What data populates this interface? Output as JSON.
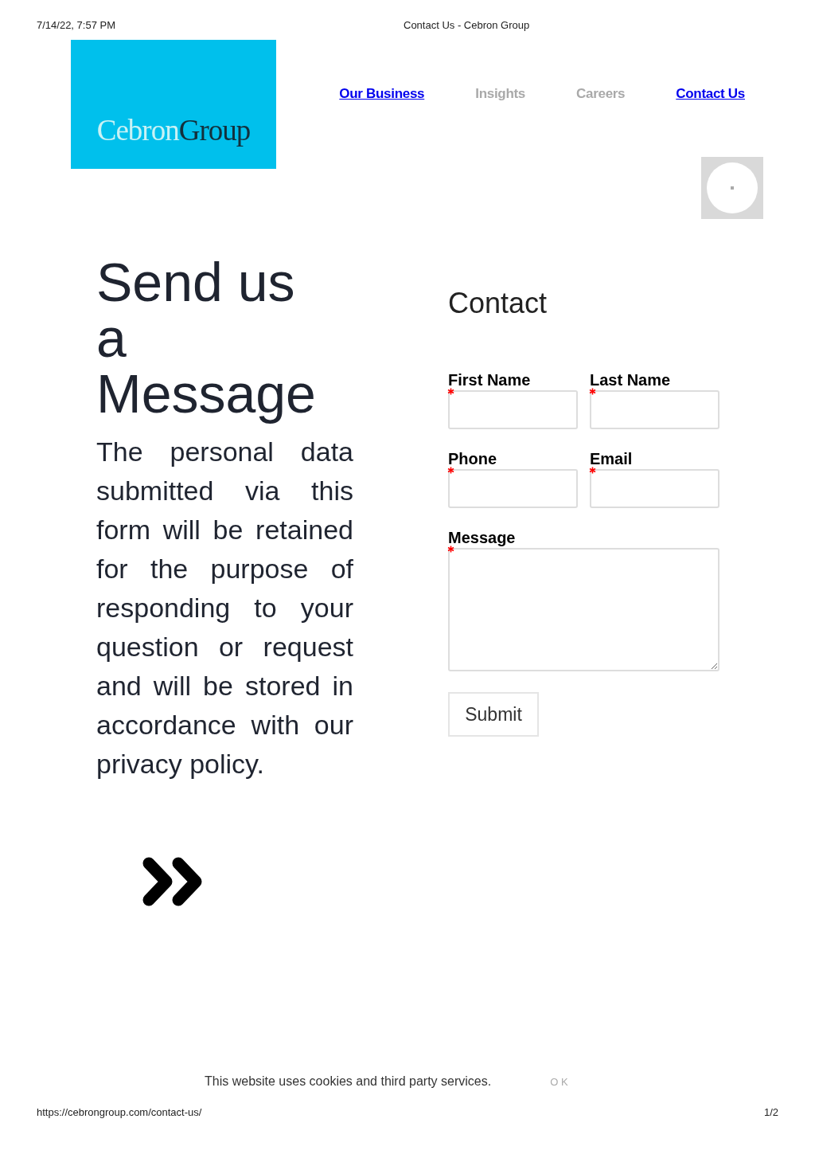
{
  "print_header": {
    "date": "7/14/22, 7:57 PM",
    "title": "Contact Us - Cebron Group"
  },
  "logo": {
    "first": "Cebron",
    "second": "Group"
  },
  "nav": [
    {
      "label": "Our Business",
      "kind": "link"
    },
    {
      "label": "Insights",
      "kind": "plain"
    },
    {
      "label": "Careers",
      "kind": "plain"
    },
    {
      "label": "Contact Us",
      "kind": "link"
    }
  ],
  "heading": "Send us a Message",
  "notice": "The personal data submitted via this form will be retained for the purpose of responding to your question or request and will be stored in accordance with our privacy policy.",
  "form": {
    "title": "Contact",
    "fields": [
      {
        "label": "First Name",
        "kind": "input",
        "required": true
      },
      {
        "label": "Last Name",
        "kind": "input",
        "required": true
      },
      {
        "label": "Phone",
        "kind": "input",
        "required": true
      },
      {
        "label": "Email",
        "kind": "input",
        "required": true
      },
      {
        "label": "Message",
        "kind": "textarea",
        "required": true
      }
    ],
    "submit": "Submit"
  },
  "cookie_bar": {
    "text": "This website uses cookies and third party services.",
    "button": "O K"
  },
  "print_footer": {
    "url": "https://cebrongroup.com/contact-us/",
    "page": "1/2"
  }
}
